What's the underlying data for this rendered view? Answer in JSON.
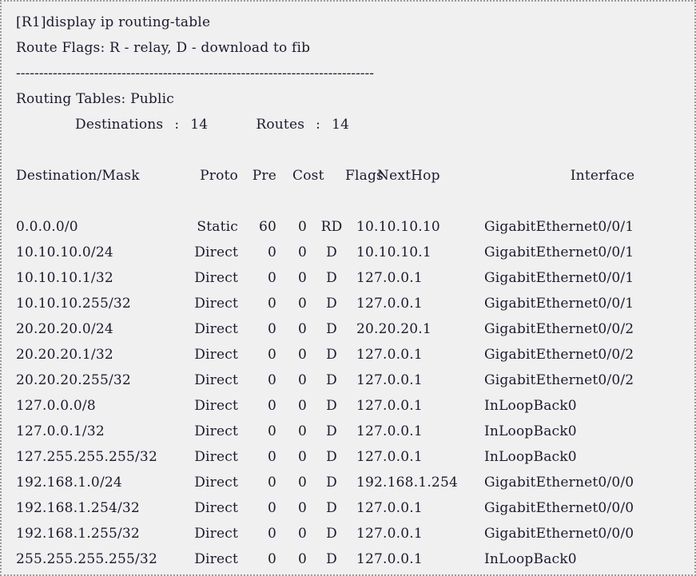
{
  "terminal": {
    "prompt_line": "[R1]display ip routing-table",
    "route_flags_line": "Route Flags: R - relay, D - download to fib",
    "separator": "------------------------------------------------------------------------------",
    "routing_tables_line": "Routing Tables: Public",
    "destinations_label": "Destinations",
    "destinations_separator": ":",
    "destinations_count": "14",
    "routes_label": "Routes",
    "routes_separator": ":",
    "routes_count": "14"
  },
  "table": {
    "headers": {
      "destination": "Destination/Mask",
      "proto": "Proto",
      "pre": "Pre",
      "cost": "Cost",
      "flags": "Flags",
      "nexthop": "NextHop",
      "interface": "Interface"
    },
    "rows": [
      {
        "destination": "0.0.0.0/0",
        "proto": "Static",
        "pre": "60",
        "cost": "0",
        "flags": "RD",
        "nexthop": "10.10.10.10",
        "interface": "GigabitEthernet0/0/1"
      },
      {
        "destination": "10.10.10.0/24",
        "proto": "Direct",
        "pre": "0",
        "cost": "0",
        "flags": "D",
        "nexthop": "10.10.10.1",
        "interface": "GigabitEthernet0/0/1"
      },
      {
        "destination": "10.10.10.1/32",
        "proto": "Direct",
        "pre": "0",
        "cost": "0",
        "flags": "D",
        "nexthop": "127.0.0.1",
        "interface": "GigabitEthernet0/0/1"
      },
      {
        "destination": "10.10.10.255/32",
        "proto": "Direct",
        "pre": "0",
        "cost": "0",
        "flags": "D",
        "nexthop": "127.0.0.1",
        "interface": "GigabitEthernet0/0/1"
      },
      {
        "destination": "20.20.20.0/24",
        "proto": "Direct",
        "pre": "0",
        "cost": "0",
        "flags": "D",
        "nexthop": "20.20.20.1",
        "interface": "GigabitEthernet0/0/2"
      },
      {
        "destination": "20.20.20.1/32",
        "proto": "Direct",
        "pre": "0",
        "cost": "0",
        "flags": "D",
        "nexthop": "127.0.0.1",
        "interface": "GigabitEthernet0/0/2"
      },
      {
        "destination": "20.20.20.255/32",
        "proto": "Direct",
        "pre": "0",
        "cost": "0",
        "flags": "D",
        "nexthop": "127.0.0.1",
        "interface": "GigabitEthernet0/0/2"
      },
      {
        "destination": "127.0.0.0/8",
        "proto": "Direct",
        "pre": "0",
        "cost": "0",
        "flags": "D",
        "nexthop": "127.0.0.1",
        "interface": "InLoopBack0"
      },
      {
        "destination": "127.0.0.1/32",
        "proto": "Direct",
        "pre": "0",
        "cost": "0",
        "flags": "D",
        "nexthop": "127.0.0.1",
        "interface": "InLoopBack0"
      },
      {
        "destination": "127.255.255.255/32",
        "proto": "Direct",
        "pre": "0",
        "cost": "0",
        "flags": "D",
        "nexthop": "127.0.0.1",
        "interface": "InLoopBack0"
      },
      {
        "destination": "192.168.1.0/24",
        "proto": "Direct",
        "pre": "0",
        "cost": "0",
        "flags": "D",
        "nexthop": "192.168.1.254",
        "interface": "GigabitEthernet0/0/0"
      },
      {
        "destination": "192.168.1.254/32",
        "proto": "Direct",
        "pre": "0",
        "cost": "0",
        "flags": "D",
        "nexthop": "127.0.0.1",
        "interface": "GigabitEthernet0/0/0"
      },
      {
        "destination": "192.168.1.255/32",
        "proto": "Direct",
        "pre": "0",
        "cost": "0",
        "flags": "D",
        "nexthop": "127.0.0.1",
        "interface": "GigabitEthernet0/0/0"
      },
      {
        "destination": "255.255.255.255/32",
        "proto": "Direct",
        "pre": "0",
        "cost": "0",
        "flags": "D",
        "nexthop": "127.0.0.1",
        "interface": "InLoopBack0"
      }
    ]
  },
  "colors": {
    "background": "#f0f0f0",
    "text": "#1a1a2e",
    "border": "#9a9a9a"
  }
}
